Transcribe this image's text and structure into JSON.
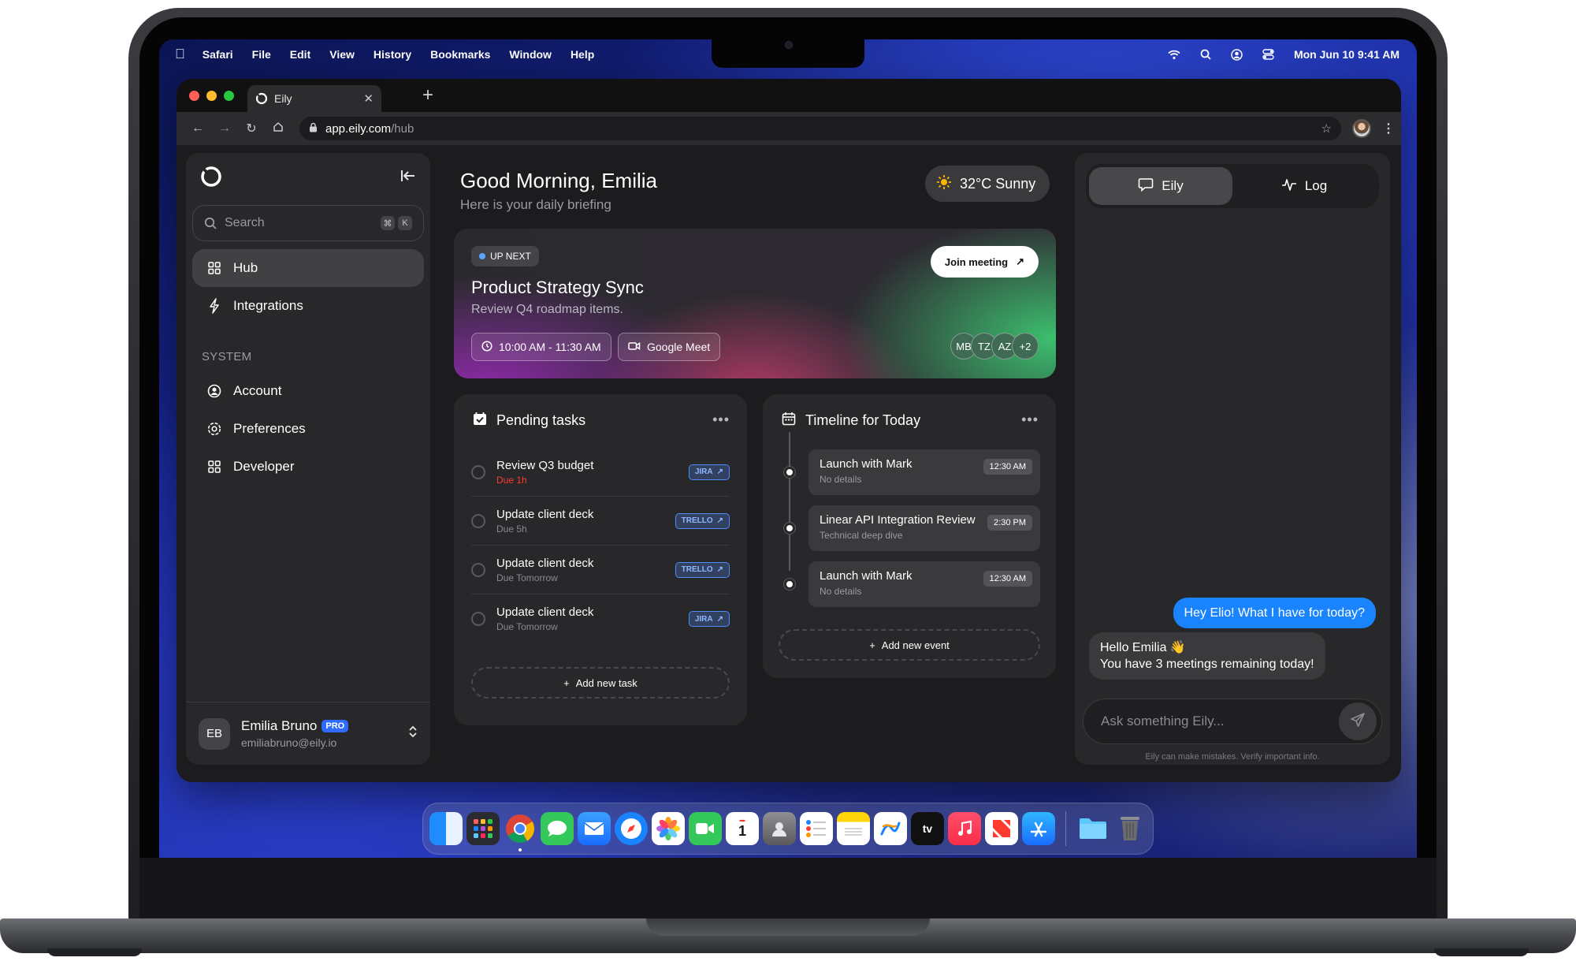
{
  "menubar": {
    "app": "Safari",
    "items": [
      "File",
      "Edit",
      "View",
      "History",
      "Bookmarks",
      "Window",
      "Help"
    ],
    "clock": "Mon Jun 10  9:41 AM"
  },
  "browser": {
    "tab_title": "Eily",
    "url_host": "app.eily.com",
    "url_path": "/hub"
  },
  "sidebar": {
    "search_placeholder": "Search",
    "shortcut_keys": [
      "⌘",
      "K"
    ],
    "nav": [
      {
        "label": "Hub",
        "icon": "grid-icon",
        "active": true
      },
      {
        "label": "Integrations",
        "icon": "bolt-icon",
        "active": false
      }
    ],
    "section_label": "SYSTEM",
    "system": [
      {
        "label": "Account",
        "icon": "user-circle-icon"
      },
      {
        "label": "Preferences",
        "icon": "gear-icon"
      },
      {
        "label": "Developer",
        "icon": "grid-icon"
      }
    ],
    "user": {
      "initials": "EB",
      "name": "Emilia Bruno",
      "badge": "PRO",
      "email": "emiliabruno@eily.io"
    }
  },
  "header": {
    "greeting": "Good Morning, Emilia",
    "subtitle": "Here is your daily briefing",
    "weather": "32°C Sunny"
  },
  "up_next": {
    "badge": "UP NEXT",
    "title": "Product Strategy Sync",
    "description": "Review Q4 roadmap items.",
    "join_label": "Join meeting",
    "time": "10:00 AM - 11:30 AM",
    "platform": "Google Meet",
    "attendees": [
      "MB",
      "TZ",
      "AZ",
      "+2"
    ]
  },
  "tasks": {
    "title": "Pending tasks",
    "items": [
      {
        "title": "Review Q3 budget",
        "due": "Due 1h",
        "tag": "JIRA",
        "urgent": true
      },
      {
        "title": "Update client deck",
        "due": "Due 5h",
        "tag": "TRELLO",
        "urgent": false
      },
      {
        "title": "Update client deck",
        "due": "Due Tomorrow",
        "tag": "TRELLO",
        "urgent": false
      },
      {
        "title": "Update client deck",
        "due": "Due Tomorrow",
        "tag": "JIRA",
        "urgent": false
      }
    ],
    "add_label": "Add new task"
  },
  "timeline": {
    "title": "Timeline for Today",
    "events": [
      {
        "title": "Launch with Mark",
        "sub": "No details",
        "time": "12:30 AM"
      },
      {
        "title": "Linear API Integration Review",
        "sub": "Technical deep dive",
        "time": "2:30 PM"
      },
      {
        "title": "Launch with Mark",
        "sub": "No details",
        "time": "12:30 AM"
      }
    ],
    "add_label": "Add new event"
  },
  "chat": {
    "tabs": [
      "Eily",
      "Log"
    ],
    "user_message": "Hey Elio! What I have for today?",
    "bot_line1": "Hello Emilia 👋",
    "bot_line2": "You have 3 meetings remaining today!",
    "input_placeholder": "Ask something Eily...",
    "disclaimer": "Eily can make mistakes. Verify important info."
  },
  "dock": {
    "apps": [
      "Finder",
      "Launchpad",
      "Chrome",
      "Messages",
      "Mail",
      "Safari",
      "Photos",
      "FaceTime",
      "Calendar",
      "Contacts",
      "Reminders",
      "Notes",
      "Freeform",
      "TV",
      "Music",
      "News",
      "App Store"
    ],
    "calendar_day": "1",
    "tv_label": "tv"
  }
}
